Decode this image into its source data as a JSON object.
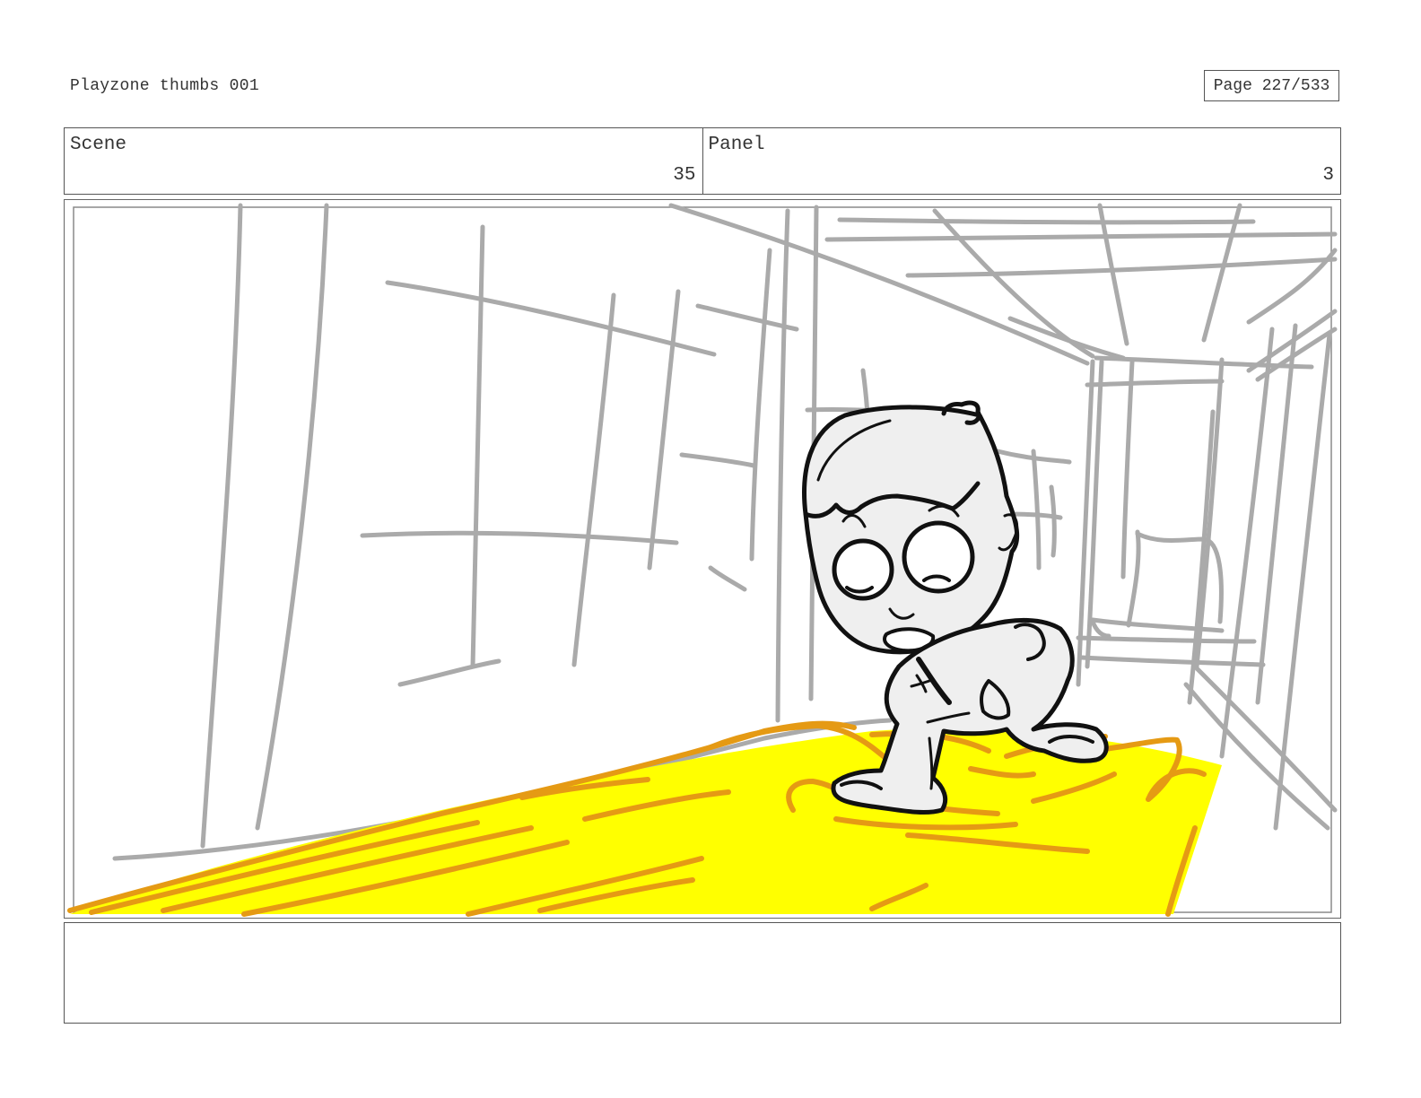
{
  "header": {
    "title": "Playzone thumbs 001",
    "page_label": "Page 227/533"
  },
  "info": {
    "scene_label": "Scene",
    "scene_value": "35",
    "panel_label": "Panel",
    "panel_value": "3"
  },
  "colors": {
    "floor_fill": "#ffff00",
    "floor_strokes": "#e59a14",
    "background_lines": "#aaaaaa",
    "character_lines": "#111111",
    "character_fill": "#efefef"
  },
  "notes": {
    "text": ""
  }
}
